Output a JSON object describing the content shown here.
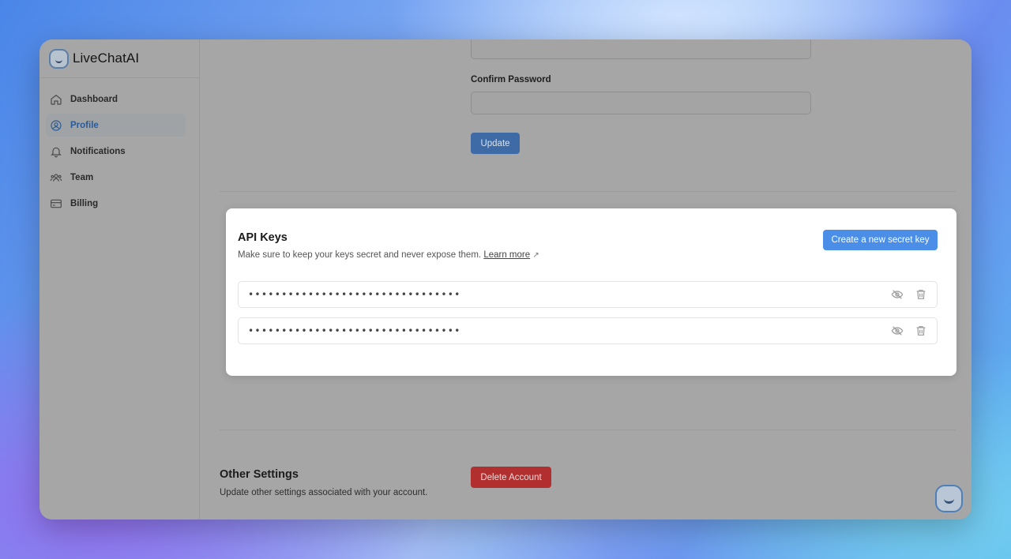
{
  "app": {
    "name": "LiveChatAI"
  },
  "sidebar": {
    "items": [
      {
        "label": "Dashboard",
        "icon": "home-icon"
      },
      {
        "label": "Profile",
        "icon": "user-circle-icon",
        "active": true
      },
      {
        "label": "Notifications",
        "icon": "bell-icon"
      },
      {
        "label": "Team",
        "icon": "users-icon"
      },
      {
        "label": "Billing",
        "icon": "credit-card-icon"
      }
    ]
  },
  "password": {
    "confirm_label": "Confirm Password",
    "update_label": "Update"
  },
  "api_keys": {
    "title": "API Keys",
    "description": "Make sure to keep your keys secret and never expose them.",
    "learn_more": "Learn more",
    "create_label": "Create a new secret key",
    "keys": [
      {
        "masked": "••••••••••••••••••••••••••••••••"
      },
      {
        "masked": "••••••••••••••••••••••••••••••••"
      }
    ]
  },
  "other_settings": {
    "title": "Other Settings",
    "description": "Update other settings associated with your account.",
    "delete_label": "Delete Account"
  },
  "colors": {
    "primary": "#4a8ee8",
    "danger": "#b22f2f",
    "active_nav": "#2b5a96"
  }
}
